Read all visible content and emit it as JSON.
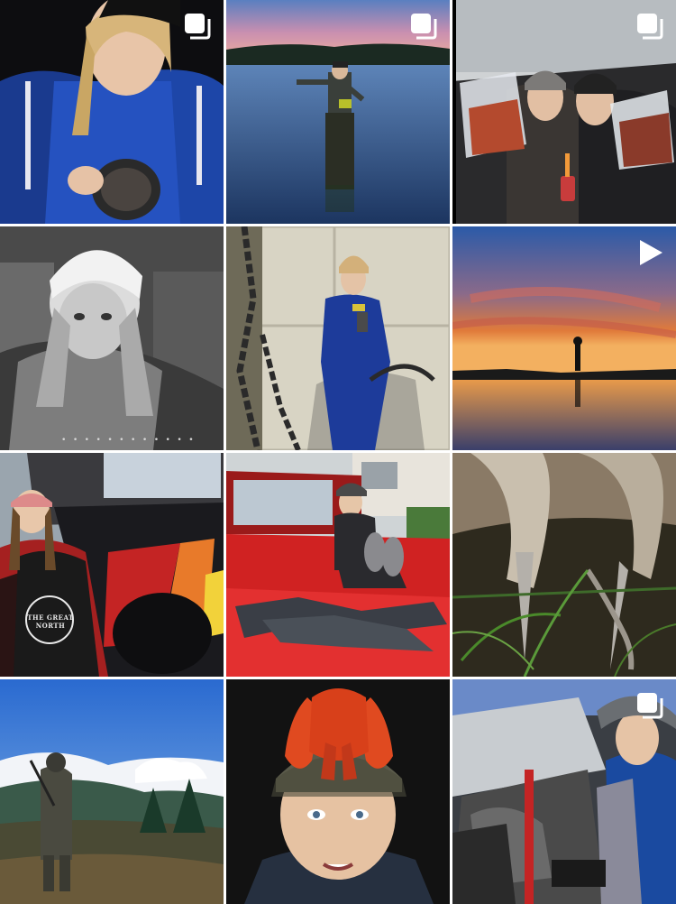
{
  "grid": {
    "tiles": [
      {
        "id": "tile-1",
        "badge": "multiple-photos-icon",
        "subject": "woman holding skull"
      },
      {
        "id": "tile-2",
        "badge": "multiple-photos-icon",
        "subject": "person in waders at lake"
      },
      {
        "id": "tile-3",
        "badge": "multiple-photos-icon",
        "subject": "two women with bags of meat"
      },
      {
        "id": "tile-4",
        "badge": "",
        "subject": "night vision selfie"
      },
      {
        "id": "tile-5",
        "badge": "",
        "subject": "woman in coveralls with chain"
      },
      {
        "id": "tile-6",
        "badge": "video-play-icon",
        "subject": "silhouette at sunset"
      },
      {
        "id": "tile-7",
        "badge": "",
        "subject": "woman by red truck"
      },
      {
        "id": "tile-8",
        "badge": "",
        "subject": "woman sitting in truck bed"
      },
      {
        "id": "tile-9",
        "badge": "",
        "subject": "bird feet on ground"
      },
      {
        "id": "tile-10",
        "badge": "",
        "subject": "hunter on mountain"
      },
      {
        "id": "tile-11",
        "badge": "",
        "subject": "woman with crayfish on cap"
      },
      {
        "id": "tile-12",
        "badge": "multiple-photos-icon",
        "subject": "woman under car hood"
      }
    ],
    "night_vision_strip": "• • • • • • • • • • • •",
    "shirt_text": "THE GREAT NORTH"
  },
  "colors": {
    "badge_white": "#ffffff",
    "accent_red": "#c61d1d",
    "jacket_blue": "#1d46a8"
  }
}
